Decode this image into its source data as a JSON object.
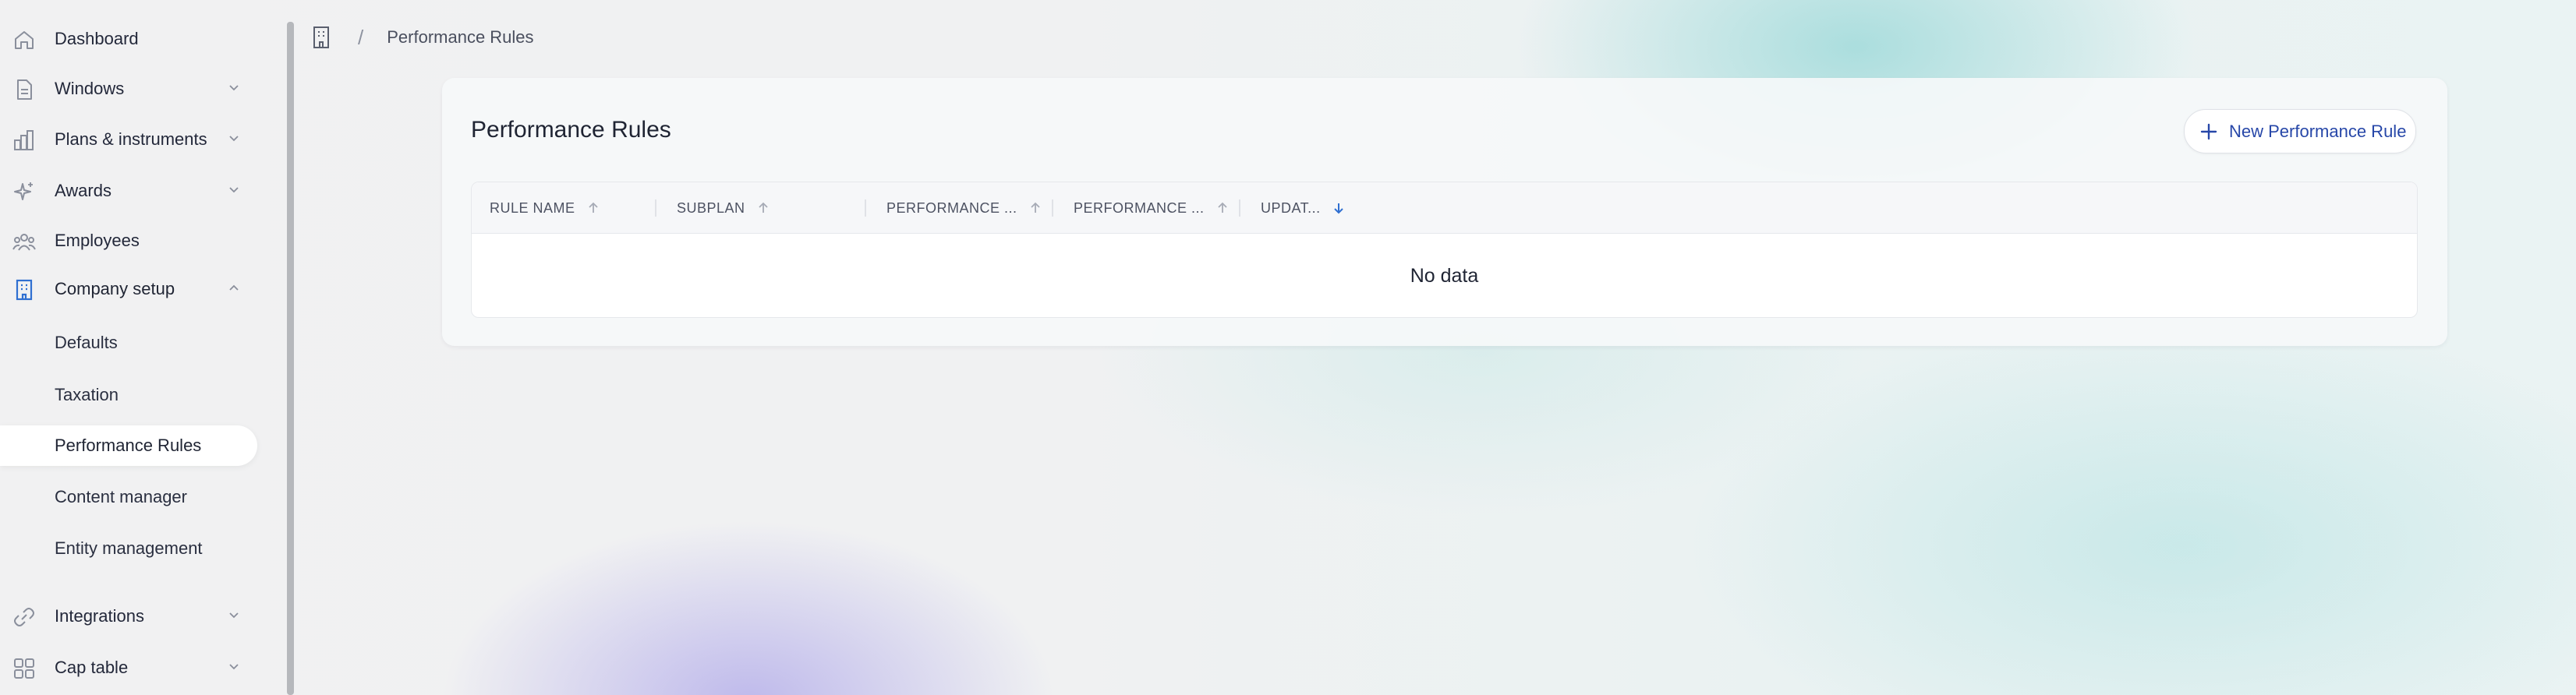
{
  "sidebar": {
    "items": [
      {
        "label": "Dashboard",
        "icon": "home-icon"
      },
      {
        "label": "Windows",
        "icon": "document-icon"
      },
      {
        "label": "Plans & instruments",
        "icon": "bar-chart-icon"
      },
      {
        "label": "Awards",
        "icon": "sparkle-icon"
      },
      {
        "label": "Employees",
        "icon": "people-icon"
      },
      {
        "label": "Company setup",
        "icon": "building-icon"
      },
      {
        "label": "Integrations",
        "icon": "link-icon"
      },
      {
        "label": "Cap table",
        "icon": "grid-icon"
      }
    ],
    "sub_items": [
      {
        "label": "Defaults"
      },
      {
        "label": "Taxation"
      },
      {
        "label": "Performance Rules"
      },
      {
        "label": "Content manager"
      },
      {
        "label": "Entity management"
      }
    ]
  },
  "breadcrumb": {
    "separator": "/",
    "current": "Performance Rules"
  },
  "card": {
    "title": "Performance Rules",
    "new_button_label": "New Performance Rule"
  },
  "table": {
    "columns": [
      {
        "label": "RULE NAME",
        "sort": "asc-inactive"
      },
      {
        "label": "SUBPLAN",
        "sort": "asc-inactive"
      },
      {
        "label": "PERFORMANCE ...",
        "sort": "asc-inactive"
      },
      {
        "label": "PERFORMANCE ...",
        "sort": "asc-inactive"
      },
      {
        "label": "UPDAT...",
        "sort": "desc-active"
      }
    ],
    "empty_text": "No data"
  },
  "colors": {
    "accent": "#2747a8",
    "active_icon": "#2f6fd1",
    "text": "#1f2433",
    "muted_icon": "#8a8f9c"
  }
}
